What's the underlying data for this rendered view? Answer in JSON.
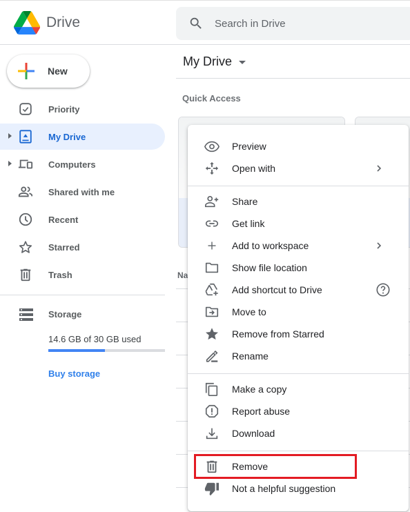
{
  "header": {
    "app_title": "Drive",
    "search_placeholder": "Search in Drive"
  },
  "sidebar": {
    "new_label": "New",
    "items": [
      {
        "label": "Priority",
        "icon": "priority-icon",
        "active": false,
        "expandable": false
      },
      {
        "label": "My Drive",
        "icon": "my-drive-icon",
        "active": true,
        "expandable": true
      },
      {
        "label": "Computers",
        "icon": "computers-icon",
        "active": false,
        "expandable": true
      },
      {
        "label": "Shared with me",
        "icon": "shared-icon",
        "active": false,
        "expandable": false
      },
      {
        "label": "Recent",
        "icon": "clock-icon",
        "active": false,
        "expandable": false
      },
      {
        "label": "Starred",
        "icon": "star-icon",
        "active": false,
        "expandable": false
      },
      {
        "label": "Trash",
        "icon": "trash-icon",
        "active": false,
        "expandable": false
      }
    ],
    "storage": {
      "label": "Storage",
      "used_text": "14.6 GB of 30 GB used",
      "used_fraction": 0.487,
      "buy_label": "Buy storage"
    }
  },
  "main": {
    "title": "My Drive",
    "quick_access_label": "Quick Access",
    "name_column_partial": "Na"
  },
  "context_menu": {
    "groups": [
      [
        {
          "label": "Preview",
          "icon": "eye-icon"
        },
        {
          "label": "Open with",
          "icon": "open-with-icon",
          "submenu": true
        }
      ],
      [
        {
          "label": "Share",
          "icon": "person-add-icon"
        },
        {
          "label": "Get link",
          "icon": "link-icon"
        },
        {
          "label": "Add to workspace",
          "icon": "plus-icon",
          "submenu": true
        },
        {
          "label": "Show file location",
          "icon": "folder-icon"
        },
        {
          "label": "Add shortcut to Drive",
          "icon": "drive-shortcut-icon",
          "help": true
        },
        {
          "label": "Move to",
          "icon": "move-to-icon"
        },
        {
          "label": "Remove from Starred",
          "icon": "star-filled-icon"
        },
        {
          "label": "Rename",
          "icon": "pencil-icon"
        }
      ],
      [
        {
          "label": "Make a copy",
          "icon": "copy-icon"
        },
        {
          "label": "Report abuse",
          "icon": "report-icon"
        },
        {
          "label": "Download",
          "icon": "download-icon"
        }
      ],
      [
        {
          "label": "Remove",
          "icon": "trash-icon",
          "highlighted": true
        },
        {
          "label": "Not a helpful suggestion",
          "icon": "thumbs-down-icon"
        }
      ]
    ]
  },
  "colors": {
    "accent": "#1a73e8",
    "active_nav_bg": "#e8f0fe",
    "highlight_box": "#e31b23",
    "storage_fill": "#4285f4"
  }
}
